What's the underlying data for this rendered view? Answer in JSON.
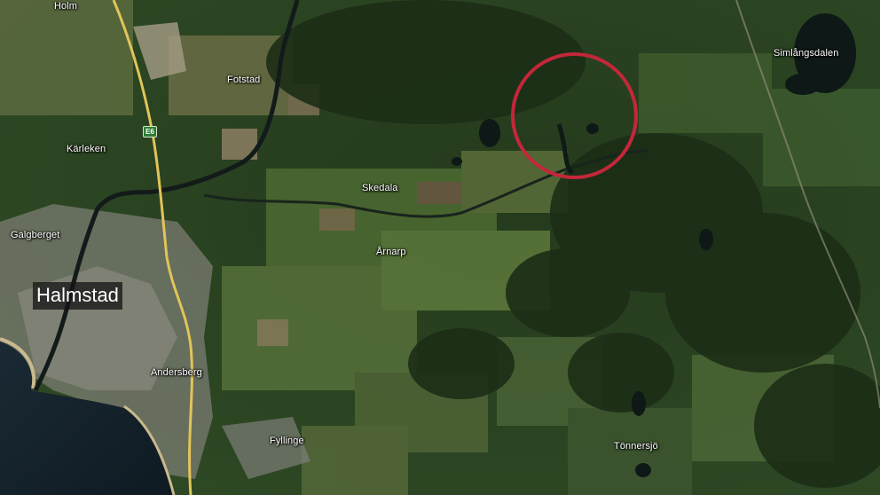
{
  "map": {
    "highlight_color": "#c4273a",
    "road_color": "#e2c45a",
    "water_color": "#13202a",
    "city": {
      "name": "Halmstad"
    },
    "road_shield": "E6",
    "places": [
      {
        "id": "holm",
        "name": "Holm"
      },
      {
        "id": "fotstad",
        "name": "Fotstad"
      },
      {
        "id": "karleken",
        "name": "Kärleken"
      },
      {
        "id": "galgberget",
        "name": "Galgberget"
      },
      {
        "id": "skedala",
        "name": "Skedala"
      },
      {
        "id": "arnarp",
        "name": "Årnarp"
      },
      {
        "id": "andersberg",
        "name": "Andersberg"
      },
      {
        "id": "fyllinge",
        "name": "Fyllinge"
      },
      {
        "id": "tonnersjo",
        "name": "Tönnersjö"
      },
      {
        "id": "simlangsdalen",
        "name": "Simlångsdalen"
      }
    ]
  }
}
